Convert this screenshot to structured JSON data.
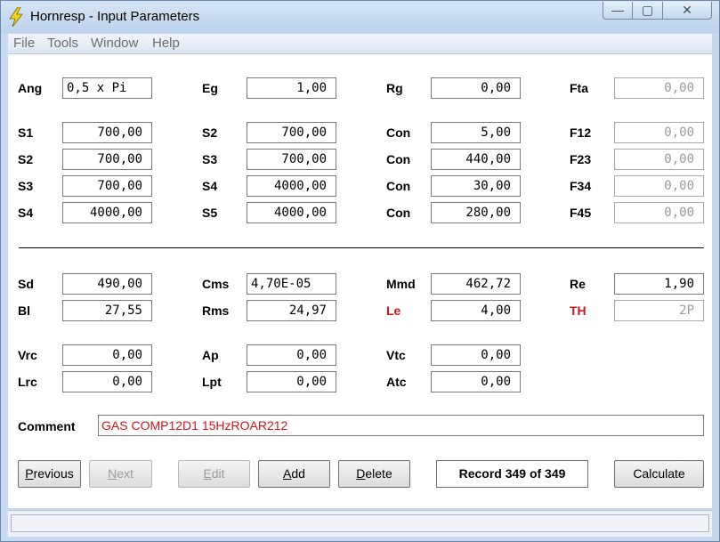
{
  "window": {
    "title": "Hornresp - Input Parameters",
    "controls": {
      "minimize": "—",
      "maximize": "▢",
      "close": "✕"
    }
  },
  "menu": [
    "File",
    "Tools",
    "Window",
    "Help"
  ],
  "params": {
    "Ang": "0,5 x Pi",
    "Eg": "1,00",
    "Rg": "0,00",
    "Fta": "0,00",
    "row1": {
      "S1": "700,00",
      "S2": "700,00",
      "Con": "5,00",
      "F12": "0,00"
    },
    "row2": {
      "S2": "700,00",
      "S3": "700,00",
      "Con": "440,00",
      "F23": "0,00"
    },
    "row3": {
      "S3": "700,00",
      "S4": "4000,00",
      "Con": "30,00",
      "F34": "0,00"
    },
    "row4": {
      "S4": "4000,00",
      "S5": "4000,00",
      "Con": "280,00",
      "F45": "0,00"
    },
    "Sd": "490,00",
    "Cms": "4,70E-05",
    "Mmd": "462,72",
    "Re": "1,90",
    "Bl": "27,55",
    "Rms": "24,97",
    "Le": "4,00",
    "TH": "2P",
    "Vrc": "0,00",
    "Ap": "0,00",
    "Vtc": "0,00",
    "Lrc": "0,00",
    "Lpt": "0,00",
    "Atc": "0,00"
  },
  "labels": {
    "ang": "Ang",
    "eg": "Eg",
    "rg": "Rg",
    "fta": "Fta",
    "s1": "S1",
    "s2": "S2",
    "s3": "S3",
    "s4": "S4",
    "s5": "S5",
    "con": "Con",
    "f12": "F12",
    "f23": "F23",
    "f34": "F34",
    "f45": "F45",
    "sd": "Sd",
    "cms": "Cms",
    "mmd": "Mmd",
    "re": "Re",
    "bl": "Bl",
    "rms": "Rms",
    "le": "Le",
    "th": "TH",
    "vrc": "Vrc",
    "ap": "Ap",
    "vtc": "Vtc",
    "lrc": "Lrc",
    "lpt": "Lpt",
    "atc": "Atc",
    "comment": "Comment"
  },
  "comment": "GAS COMP12D1 15HzROAR212",
  "buttons": {
    "previous": {
      "first": "P",
      "rest": "revious"
    },
    "next": {
      "first": "N",
      "rest": "ext"
    },
    "edit": {
      "first": "E",
      "rest": "dit"
    },
    "add": {
      "first": "A",
      "rest": "dd"
    },
    "delete": {
      "first": "D",
      "rest": "elete"
    },
    "calculate": "Calculate"
  },
  "record": "Record 349 of 349",
  "colors": {
    "accent_red": "#d2141c",
    "window_frame": "#c6d9ee"
  }
}
